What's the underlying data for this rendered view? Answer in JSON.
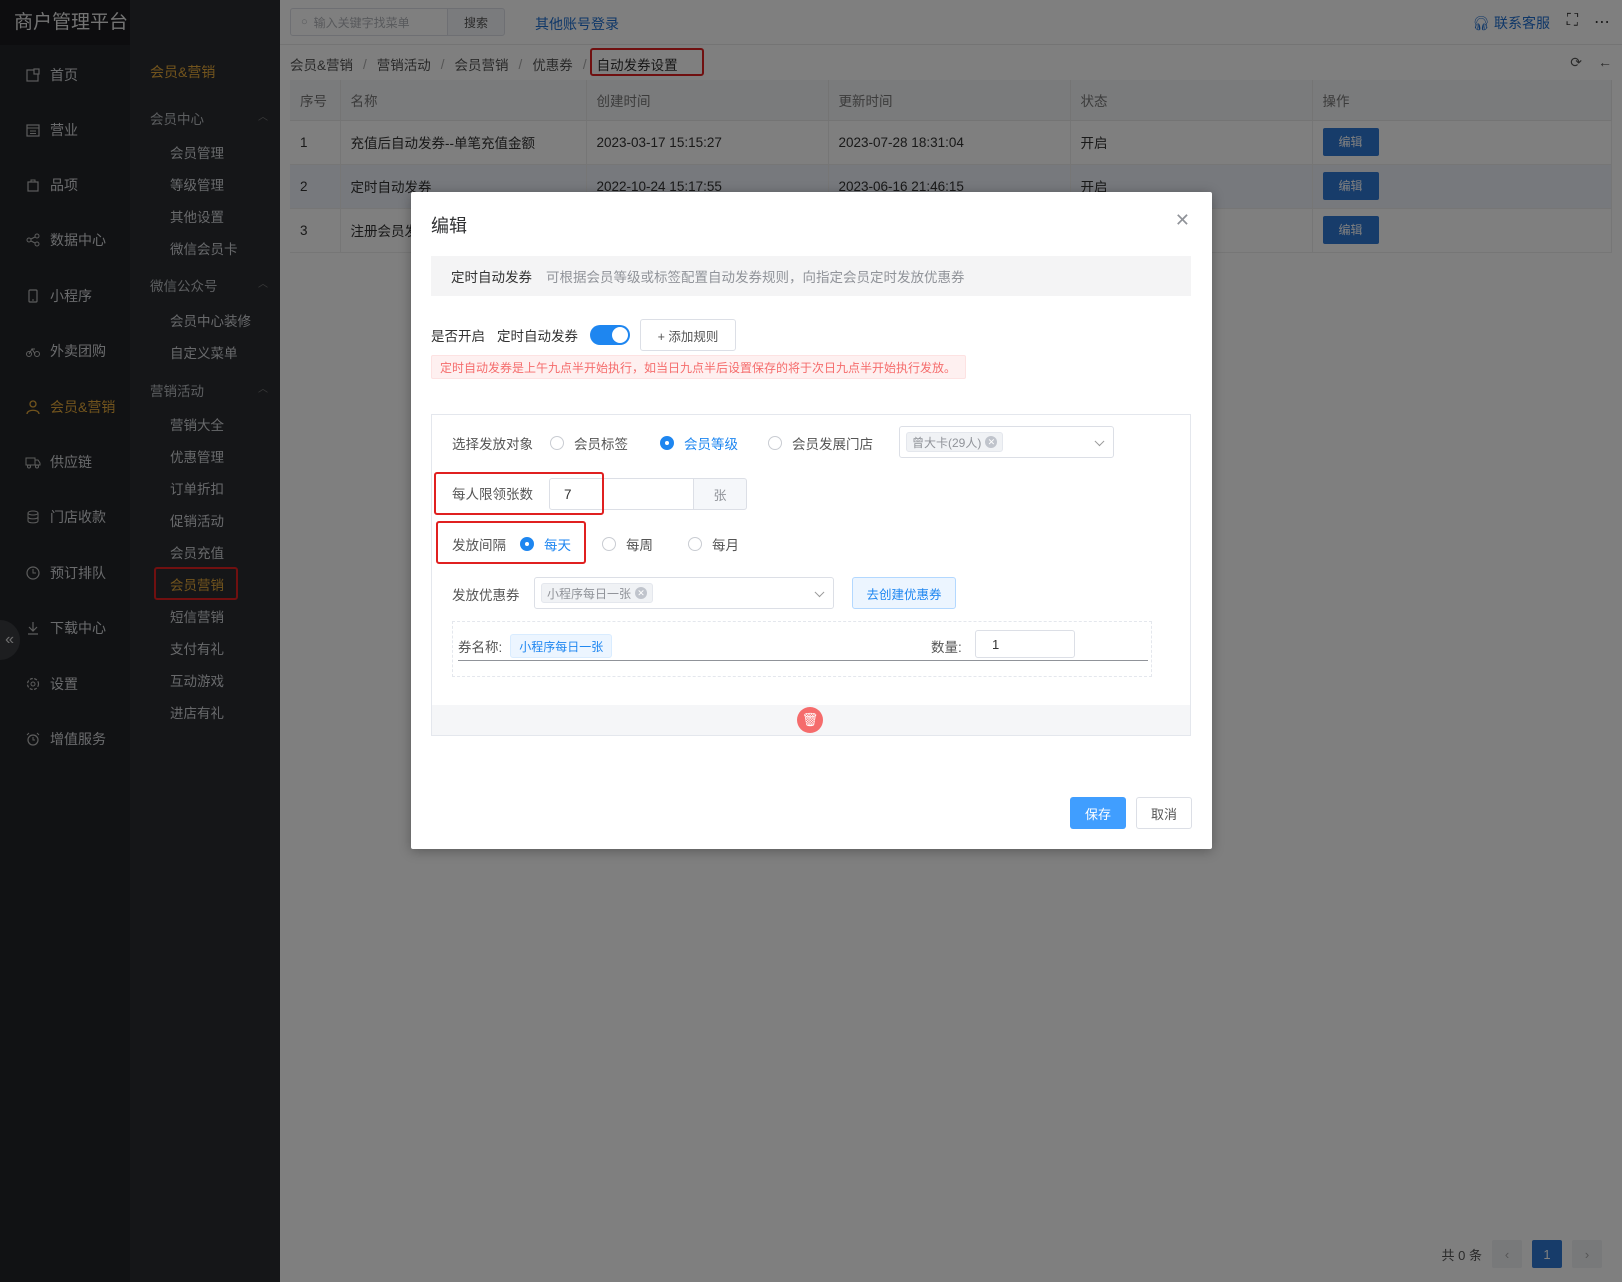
{
  "app": {
    "title": "商户管理平台"
  },
  "sidebar_main": {
    "items": [
      {
        "label": "首页",
        "icon": "home-icon"
      },
      {
        "label": "营业",
        "icon": "calendar-icon"
      },
      {
        "label": "品项",
        "icon": "bag-icon"
      },
      {
        "label": "数据中心",
        "icon": "share-icon"
      },
      {
        "label": "小程序",
        "icon": "phone-icon"
      },
      {
        "label": "外卖团购",
        "icon": "bike-icon"
      },
      {
        "label": "会员&营销",
        "icon": "user-icon",
        "active": true
      },
      {
        "label": "供应链",
        "icon": "truck-icon"
      },
      {
        "label": "门店收款",
        "icon": "database-icon"
      },
      {
        "label": "预订排队",
        "icon": "clock-icon"
      },
      {
        "label": "下载中心",
        "icon": "download-icon"
      },
      {
        "label": "设置",
        "icon": "gear-icon"
      },
      {
        "label": "增值服务",
        "icon": "alarm-icon"
      }
    ],
    "collapse_icon": "double-chevron-left-icon"
  },
  "sidebar_sub": {
    "title": "会员&营销",
    "groups": [
      {
        "label": "会员中心",
        "items": [
          "会员管理",
          "等级管理",
          "其他设置",
          "微信会员卡"
        ]
      },
      {
        "label": "微信公众号",
        "items": [
          "会员中心装修",
          "自定义菜单"
        ]
      },
      {
        "label": "营销活动",
        "items": [
          "营销大全",
          "优惠管理",
          "订单折扣",
          "促销活动",
          "会员充值",
          "会员营销",
          "短信营销",
          "支付有礼",
          "互动游戏",
          "进店有礼"
        ]
      }
    ],
    "active_item": "会员营销"
  },
  "topbar": {
    "search_placeholder": "输入关键字找菜单",
    "search_button": "搜索",
    "other_login": "其他账号登录",
    "contact": "联系客服"
  },
  "breadcrumb": [
    "会员&营销",
    "营销活动",
    "会员营销",
    "优惠券",
    "自动发券设置"
  ],
  "table": {
    "columns": [
      "序号",
      "名称",
      "创建时间",
      "更新时间",
      "状态",
      "操作"
    ],
    "rows": [
      {
        "no": "1",
        "name": "充值后自动发券--单笔充值金额",
        "created": "2023-03-17 15:15:27",
        "updated": "2023-07-28 18:31:04",
        "status": "开启",
        "action": "编辑"
      },
      {
        "no": "2",
        "name": "定时自动发券",
        "created": "2022-10-24 15:17:55",
        "updated": "2023-06-16 21:46:15",
        "status": "开启",
        "action": "编辑"
      },
      {
        "no": "3",
        "name": "注册会员发",
        "created": "",
        "updated": "",
        "status": "",
        "action": "编辑"
      }
    ]
  },
  "pager": {
    "total": "共 0 条",
    "current": "1"
  },
  "dialog": {
    "title": "编辑",
    "info_title": "定时自动发券",
    "info_desc": "可根据会员等级或标签配置自动发券规则，向指定会员定时发放优惠券",
    "open_label": "是否开启",
    "open_name": "定时自动发券",
    "add_rule": "+ 添加规则",
    "warning": "定时自动发券是上午九点半开始执行，如当日九点半后设置保存的将于次日九点半开始执行发放。",
    "target_label": "选择发放对象",
    "target_options": [
      "会员标签",
      "会员等级",
      "会员发展门店"
    ],
    "target_selected": "会员等级",
    "target_tag": "曾大卡(29人)",
    "limit_label": "每人限领张数",
    "limit_value": "7",
    "limit_unit": "张",
    "interval_label": "发放间隔",
    "interval_options": [
      "每天",
      "每周",
      "每月"
    ],
    "interval_selected": "每天",
    "coupon_label": "发放优惠券",
    "coupon_tag": "小程序每日一张",
    "create_coupon": "去创建优惠券",
    "coupon_name_label": "券名称:",
    "coupon_name": "小程序每日一张",
    "qty_label": "数量:",
    "qty_value": "1",
    "save": "保存",
    "cancel": "取消"
  },
  "colors": {
    "accent": "#e4a83a",
    "primary": "#409eff",
    "link": "#1f6fd1",
    "danger": "#f56c6c",
    "highlight": "#e02020"
  }
}
